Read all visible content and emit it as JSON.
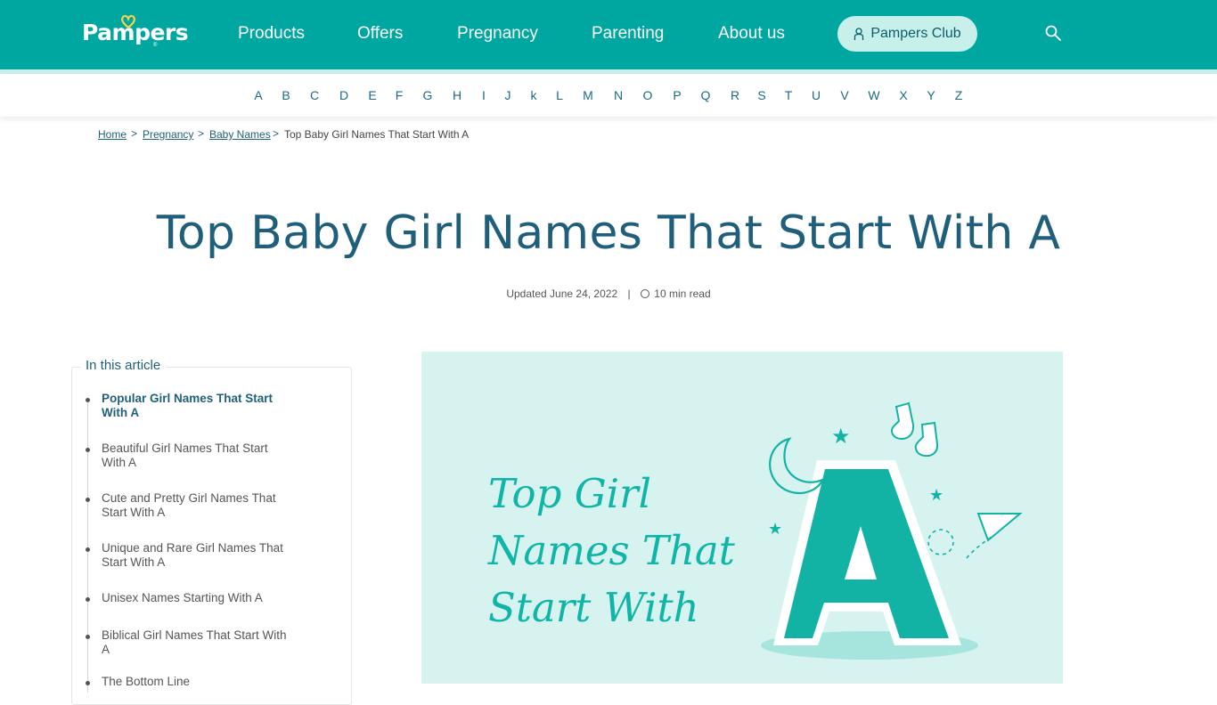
{
  "brand": {
    "logo_text": "Pampers",
    "registered": "®"
  },
  "nav": {
    "items": [
      "Products",
      "Offers",
      "Pregnancy",
      "Parenting",
      "About us"
    ],
    "club_label": "Pampers Club"
  },
  "alphabet": [
    "A",
    "B",
    "C",
    "D",
    "E",
    "F",
    "G",
    "H",
    "I",
    "J",
    "k",
    "L",
    "M",
    "N",
    "O",
    "P",
    "Q",
    "R",
    "S",
    "T",
    "U",
    "V",
    "W",
    "X",
    "Y",
    "Z"
  ],
  "breadcrumb": {
    "links": [
      "Home",
      "Pregnancy",
      "Baby Names"
    ],
    "separator": ">",
    "current": "Top Baby Girl Names That Start With A"
  },
  "article": {
    "title": "Top Baby Girl Names That Start With A",
    "updated": "Updated June 24, 2022",
    "divider": "|",
    "read_time": "10 min read"
  },
  "toc": {
    "heading": "In this article",
    "items": [
      "Popular Girl Names That Start With A",
      "Beautiful Girl Names That Start With A",
      "Cute and Pretty Girl Names That Start With A",
      "Unique and Rare Girl Names That Start With A",
      "Unisex Names Starting With A",
      "Biblical Girl Names That Start With A",
      "The Bottom Line"
    ]
  },
  "hero": {
    "lines": [
      "Top Girl",
      "Names That",
      "Start With"
    ],
    "letter": "A"
  },
  "colors": {
    "brand_teal": "#00a7a0",
    "club_button": "#c8f0eb",
    "heading_blue": "#1f5f7c",
    "hero_bg": "#d7f3ef",
    "hero_accent": "#10b5a8"
  }
}
